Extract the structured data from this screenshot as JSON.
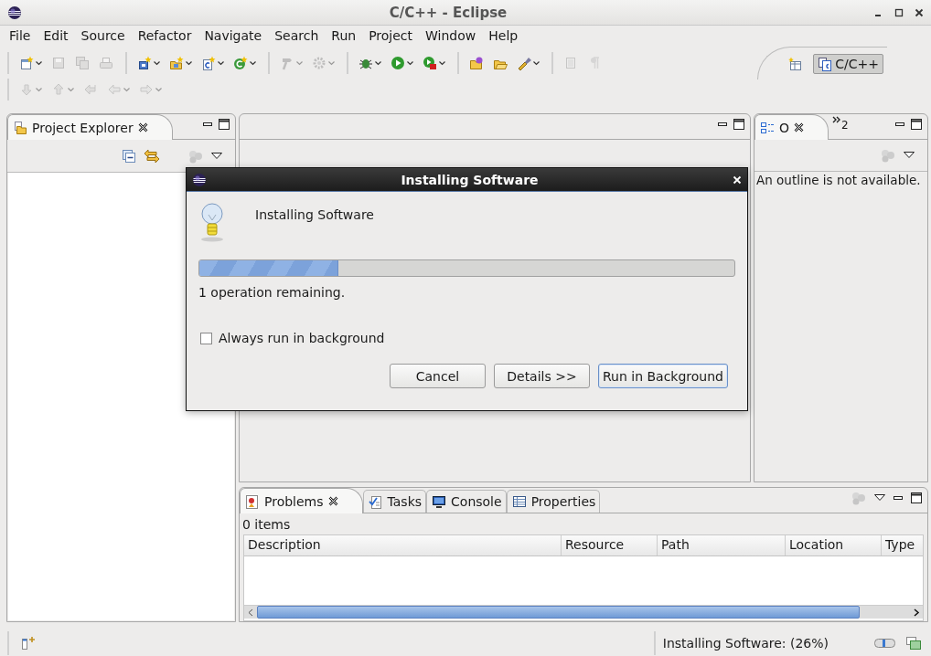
{
  "window": {
    "title": "C/C++ - Eclipse"
  },
  "menu": [
    "File",
    "Edit",
    "Source",
    "Refactor",
    "Navigate",
    "Search",
    "Run",
    "Project",
    "Window",
    "Help"
  ],
  "toolbar": {
    "rows": [
      {
        "groups": [
          {
            "items": [
              {
                "disabled": false,
                "dropdown": true
              },
              {
                "disabled": true,
                "dropdown": false
              },
              {
                "disabled": true,
                "dropdown": false
              },
              {
                "disabled": true,
                "dropdown": false
              }
            ]
          },
          {
            "items": [
              {
                "disabled": false,
                "dropdown": true
              },
              {
                "disabled": false,
                "dropdown": true
              },
              {
                "disabled": false,
                "dropdown": true
              },
              {
                "disabled": false,
                "dropdown": true
              }
            ]
          },
          {
            "items": [
              {
                "disabled": true,
                "dropdown": true
              },
              {
                "disabled": true,
                "dropdown": true
              }
            ]
          },
          {
            "items": [
              {
                "disabled": false,
                "dropdown": true
              },
              {
                "disabled": false,
                "dropdown": true
              },
              {
                "disabled": false,
                "dropdown": true
              }
            ]
          },
          {
            "items": [
              {
                "disabled": false,
                "dropdown": false
              },
              {
                "disabled": false,
                "dropdown": false
              },
              {
                "disabled": false,
                "dropdown": true
              }
            ]
          },
          {
            "items": [
              {
                "disabled": true,
                "dropdown": false
              },
              {
                "disabled": true,
                "dropdown": false
              }
            ]
          }
        ]
      },
      {
        "groups": [
          {
            "items": [
              {
                "disabled": true,
                "dropdown": true
              },
              {
                "disabled": true,
                "dropdown": true
              },
              {
                "disabled": true,
                "dropdown": false
              },
              {
                "disabled": true,
                "dropdown": true
              },
              {
                "disabled": true,
                "dropdown": true
              }
            ]
          }
        ]
      }
    ]
  },
  "perspectives": [
    {
      "label": "C/C++",
      "selected": true
    }
  ],
  "project_explorer": {
    "tabs": [
      {
        "label": "Project Explorer",
        "selected": true
      }
    ]
  },
  "outline": {
    "tabs": [
      {
        "label": "O",
        "selected": true
      }
    ],
    "overflow_count": "2",
    "message": "An outline is not available."
  },
  "problems": {
    "tabs": [
      {
        "label": "Problems",
        "selected": true
      },
      {
        "label": "Tasks",
        "selected": false
      },
      {
        "label": "Console",
        "selected": false
      },
      {
        "label": "Properties",
        "selected": false
      }
    ],
    "summary": "0 items",
    "columns": [
      "Description",
      "Resource",
      "Path",
      "Location",
      "Type"
    ]
  },
  "status_bar": {
    "message": "Installing Software: (26%)"
  },
  "dialog": {
    "title": "Installing Software",
    "task": "Installing Software",
    "level": 0.26,
    "remaining": "1 operation remaining.",
    "checkbox": {
      "label": "Always run in background",
      "checked": false
    },
    "buttons": [
      {
        "label": "Cancel",
        "default": false
      },
      {
        "label": "Details >>",
        "default": false
      },
      {
        "label": "Run in Background",
        "default": true
      }
    ]
  }
}
